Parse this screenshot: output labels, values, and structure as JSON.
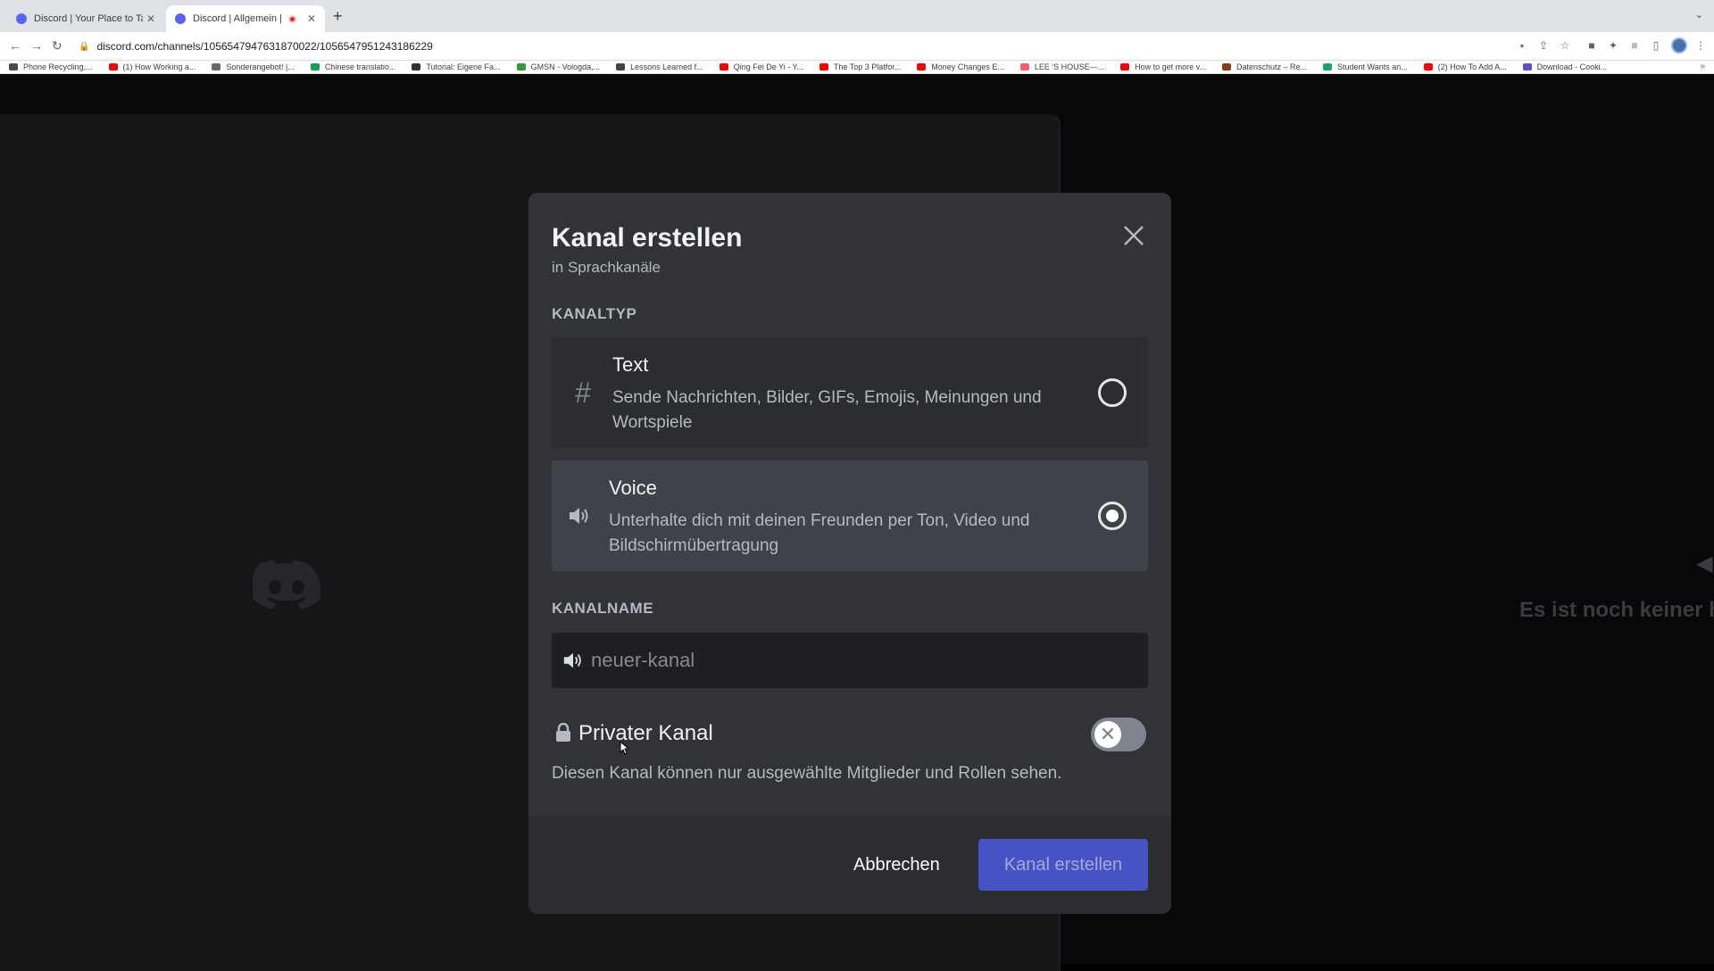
{
  "browser": {
    "tabs": [
      {
        "title": "Discord | Your Place to Talk an"
      },
      {
        "title": "Discord | Allgemein | Serve"
      }
    ],
    "new_tab_icon": "+",
    "url": "discord.com/channels/1056547947631870022/1056547951243186229",
    "bookmarks": [
      {
        "label": "Phone Recycling,...",
        "color": "#4a4a4a"
      },
      {
        "label": "(1) How Working a...",
        "color": "#ff0000"
      },
      {
        "label": "Sonderangebot! |...",
        "color": "#6b6b6b"
      },
      {
        "label": "Chinese translatio...",
        "color": "#12a150"
      },
      {
        "label": "Tutorial: Eigene Fa...",
        "color": "#333333"
      },
      {
        "label": "GMSN - Vologda,...",
        "color": "#2e9e3e"
      },
      {
        "label": "Lessons Learned f...",
        "color": "#444444"
      },
      {
        "label": "Qing Fei De Yi - Y...",
        "color": "#ff0000"
      },
      {
        "label": "The Top 3 Platfor...",
        "color": "#ff0000"
      },
      {
        "label": "Money Changes E...",
        "color": "#ff0000"
      },
      {
        "label": "LEE 'S HOUSE—...",
        "color": "#ff5a5f"
      },
      {
        "label": "How to get more v...",
        "color": "#ff0000"
      },
      {
        "label": "Datenschutz – Re...",
        "color": "#8b3a1a"
      },
      {
        "label": "Student Wants an...",
        "color": "#1aa37a"
      },
      {
        "label": "(2) How To Add A...",
        "color": "#ff0000"
      },
      {
        "label": "Download - Cooki...",
        "color": "#5a4fcf"
      }
    ]
  },
  "background": {
    "empty_text": "Es ist noch keiner hi"
  },
  "modal": {
    "title": "Kanal erstellen",
    "subtitle": "in Sprachkanäle",
    "channel_type_label": "KANALTYP",
    "options": [
      {
        "icon": "#",
        "name": "Text",
        "description": "Sende Nachrichten, Bilder, GIFs, Emojis, Meinungen und Wortspiele",
        "selected": false
      },
      {
        "icon": "speaker-icon",
        "name": "Voice",
        "description": "Unterhalte dich mit deinen Freunden per Ton, Video und Bildschirmübertragung",
        "selected": true
      }
    ],
    "channel_name_label": "KANALNAME",
    "channel_name_placeholder": "neuer-kanal",
    "channel_name_value": "",
    "private_label": "Privater Kanal",
    "private_enabled": false,
    "private_description": "Diesen Kanal können nur ausgewählte Mitglieder und Rollen sehen.",
    "cancel_label": "Abbrechen",
    "create_label": "Kanal erstellen"
  },
  "colors": {
    "modal_bg": "#313338",
    "footer_bg": "#2b2d31",
    "accent": "#5865f2"
  }
}
